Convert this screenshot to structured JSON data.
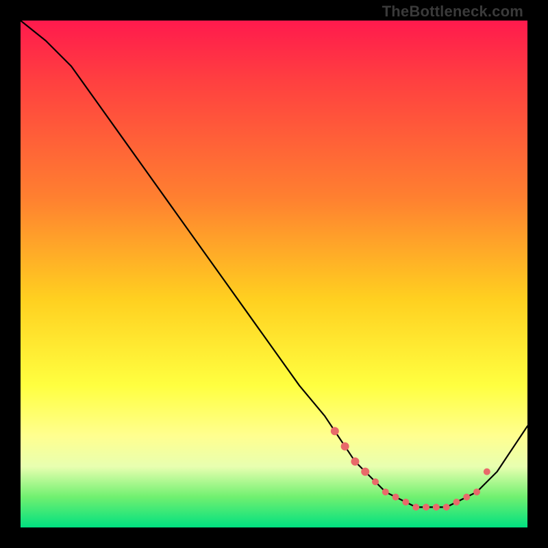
{
  "watermark": "TheBottleneck.com",
  "colors": {
    "frame": "#000000",
    "gradient_top": "#ff1a4d",
    "gradient_mid1": "#ff8030",
    "gradient_mid2": "#ffff40",
    "gradient_bottom": "#00e080",
    "curve": "#000000",
    "dot": "#e86a6a"
  },
  "chart_data": {
    "type": "line",
    "title": "",
    "xlabel": "",
    "ylabel": "",
    "xlim": [
      0,
      100
    ],
    "ylim": [
      0,
      100
    ],
    "x": [
      0,
      5,
      10,
      15,
      20,
      25,
      30,
      35,
      40,
      45,
      50,
      55,
      60,
      62,
      64,
      66,
      68,
      70,
      72,
      74,
      76,
      78,
      80,
      82,
      84,
      86,
      88,
      90,
      92,
      94,
      96,
      98,
      100
    ],
    "y": [
      100,
      96,
      91,
      84,
      77,
      70,
      63,
      56,
      49,
      42,
      35,
      28,
      22,
      19,
      16,
      13,
      11,
      9,
      7,
      6,
      5,
      4,
      4,
      4,
      4,
      5,
      6,
      7,
      9,
      11,
      14,
      17,
      20
    ],
    "marker_points": {
      "x": [
        62,
        64,
        66,
        68,
        70,
        72,
        74,
        76,
        78,
        80,
        82,
        84,
        86,
        88,
        90,
        92
      ],
      "y": [
        19,
        16,
        13,
        11,
        9,
        7,
        6,
        5,
        4,
        4,
        4,
        4,
        5,
        6,
        7,
        11
      ]
    },
    "annotations": []
  }
}
